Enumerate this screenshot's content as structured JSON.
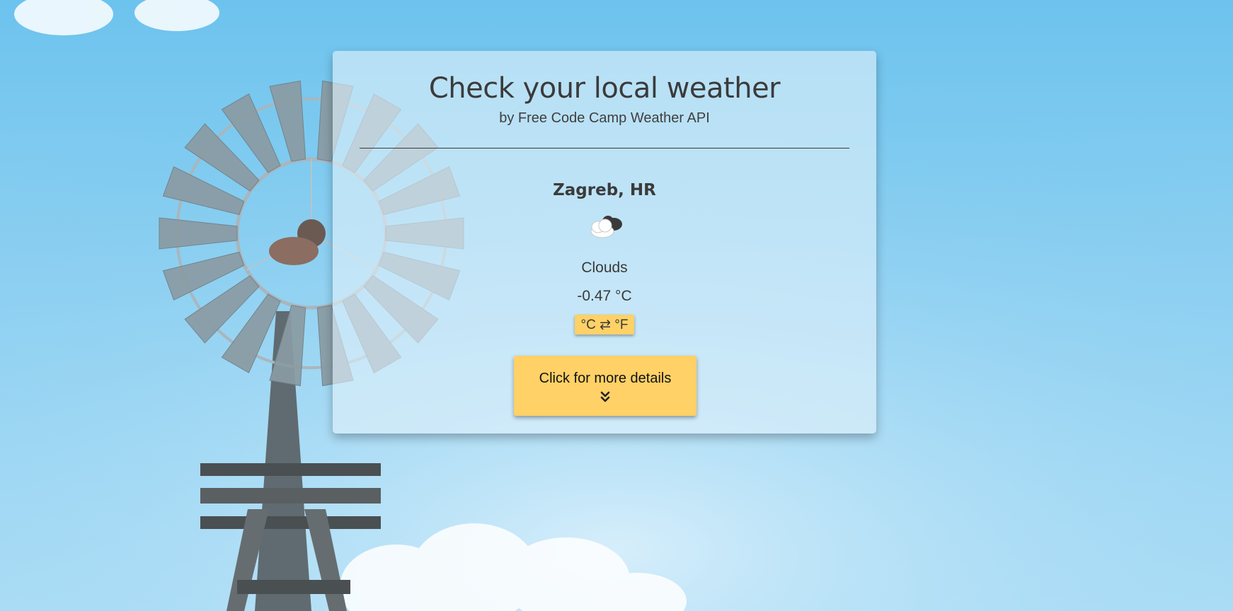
{
  "header": {
    "title": "Check your local weather",
    "subtitle": "by Free Code Camp Weather API"
  },
  "weather": {
    "location": "Zagreb, HR",
    "icon": "clouds-icon",
    "condition": "Clouds",
    "temperature": "-0.47 °C",
    "unit_toggle_label": "°C ⇄ °F"
  },
  "details_button": {
    "label": "Click for more details",
    "icon": "chevron-double-down-icon"
  },
  "colors": {
    "sky": "#7ccaf0",
    "card": "#e1f0fa",
    "accent": "#ffd166",
    "text": "#3b3b3b"
  }
}
